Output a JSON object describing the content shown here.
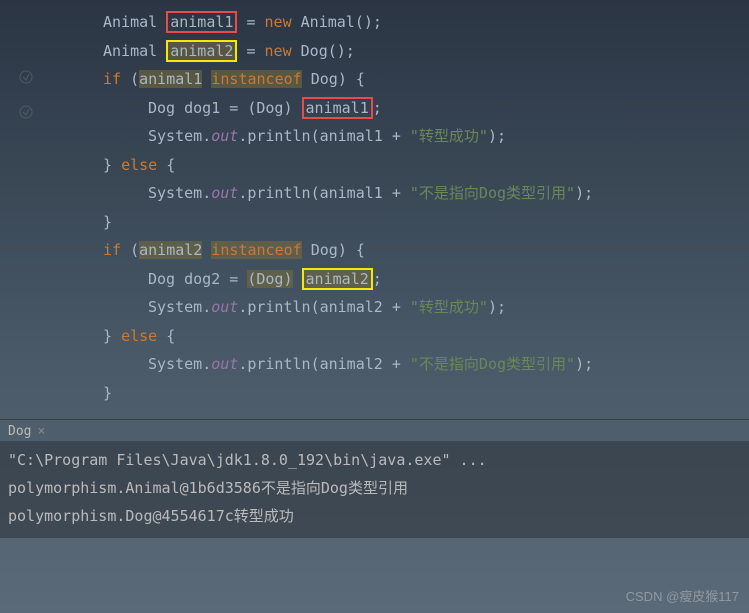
{
  "code": {
    "l1": {
      "type": "Animal",
      "var": "animal1",
      "kw": "new",
      "ctor": "Animal"
    },
    "l2": {
      "type": "Animal",
      "var": "animal2",
      "kw": "new",
      "ctor": "Dog"
    },
    "l3": {
      "if": "if",
      "v": "animal1",
      "ins": "instanceof",
      "t": "Dog"
    },
    "l4": {
      "type": "Dog",
      "var": "dog1",
      "cast": "Dog",
      "src": "animal1"
    },
    "l5": {
      "sys": "System",
      "out": "out",
      "pr": "println",
      "v": "animal1",
      "plus": "+",
      "s": "\"转型成功\""
    },
    "l6": {
      "brace": "}",
      "else": "else",
      "ob": "{"
    },
    "l7": {
      "sys": "System",
      "out": "out",
      "pr": "println",
      "v": "animal1",
      "plus": "+",
      "s": "\"不是指向Dog类型引用\""
    },
    "l8": {
      "brace": "}"
    },
    "l9": {
      "if": "if",
      "v": "animal2",
      "ins": "instanceof",
      "t": "Dog"
    },
    "l10": {
      "type": "Dog",
      "var": "dog2",
      "cast": "Dog",
      "src": "animal2"
    },
    "l11": {
      "sys": "System",
      "out": "out",
      "pr": "println",
      "v": "animal2",
      "plus": "+",
      "s": "\"转型成功\""
    },
    "l12": {
      "brace": "}",
      "else": "else",
      "ob": "{"
    },
    "l13": {
      "sys": "System",
      "out": "out",
      "pr": "println",
      "v": "animal2",
      "plus": "+",
      "s": "\"不是指向Dog类型引用\""
    },
    "l14": {
      "brace": "}"
    }
  },
  "console": {
    "tab": "Dog",
    "close": "×",
    "line1": "\"C:\\Program Files\\Java\\jdk1.8.0_192\\bin\\java.exe\" ...",
    "line2": "polymorphism.Animal@1b6d3586不是指向Dog类型引用",
    "line3": "polymorphism.Dog@4554617c转型成功"
  },
  "watermark": "CSDN @瘦皮猴117"
}
